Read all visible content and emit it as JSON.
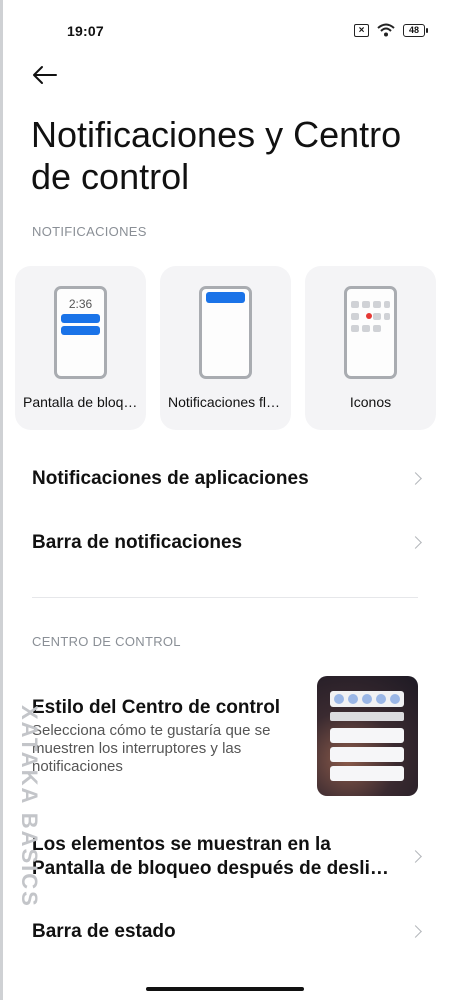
{
  "status": {
    "time": "19:07",
    "battery": "48",
    "sim_icon": "sim-off-icon",
    "wifi_icon": "wifi-icon"
  },
  "header": {
    "back_icon": "arrow-left-icon",
    "title": "Notificaciones y Centro de control"
  },
  "notifications": {
    "section_label": "NOTIFICACIONES",
    "cards": [
      {
        "label": "Pantalla de bloqueo",
        "preview_time": "2:36"
      },
      {
        "label": "Notificaciones flotantes"
      },
      {
        "label": "Iconos"
      }
    ],
    "rows": [
      {
        "label": "Notificaciones de aplicaciones"
      },
      {
        "label": "Barra de notificaciones"
      }
    ]
  },
  "control_center": {
    "section_label": "CENTRO DE CONTROL",
    "style": {
      "title": "Estilo del Centro de control",
      "description": "Selecciona cómo te gustaría que se muestren los interruptores y las notificaciones"
    },
    "rows": [
      {
        "line1": "Los elementos se muestran en la",
        "line2": "Pantalla de bloqueo después de deslizar"
      },
      {
        "label": "Barra de estado"
      }
    ]
  },
  "watermark": "XATAKA BASICS",
  "colors": {
    "accent": "#1a73e8",
    "section_label": "#8a8f96",
    "card_bg": "#f4f4f6"
  }
}
